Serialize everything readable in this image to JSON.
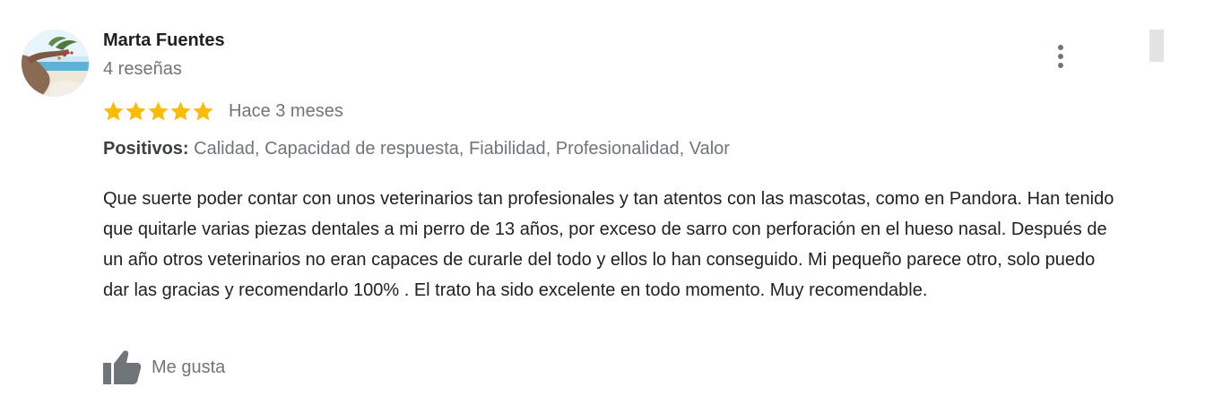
{
  "review": {
    "author_name": "Marta Fuentes",
    "review_count": "4 reseñas",
    "rating": 5,
    "rating_max": 5,
    "date": "Hace 3 meses",
    "positives_label": "Positivos:",
    "positives_values": "Calidad, Capacidad de respuesta, Fiabilidad, Profesionalidad, Valor",
    "text": "Que suerte poder contar con unos veterinarios tan profesionales y tan atentos con las mascotas, como en Pandora. Han tenido que quitarle varias piezas dentales a mi perro de 13 años, por exceso de sarro con perforación en el hueso nasal. Después de un año otros veterinarios no eran capaces de curarle del todo y ellos lo han conseguido. Mi pequeño parece otro, solo puedo dar las gracias y recomendarlo 100% . El trato ha sido excelente en todo momento. Muy recomendable.",
    "like_label": "Me gusta"
  },
  "icons": {
    "star": "star-icon",
    "more": "more-vert-icon",
    "like": "thumb-up-icon"
  },
  "colors": {
    "star": "#fbbc04",
    "name_text": "#202124",
    "secondary_text": "#70757a",
    "body_text": "#202124"
  }
}
